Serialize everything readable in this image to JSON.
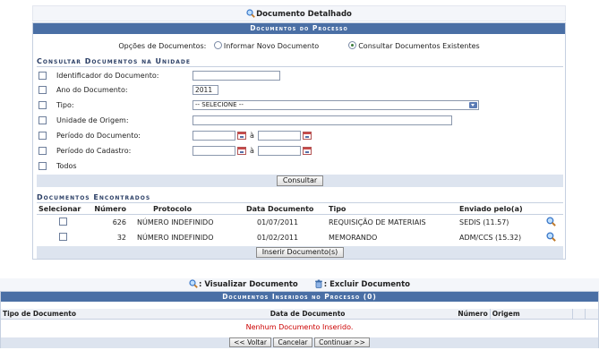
{
  "detalhado_title": "Documento Detalhado",
  "main": {
    "caption": "Documentos do Processo",
    "options_label": "Opções de Documentos:",
    "option_informar": "Informar Novo Documento",
    "option_consultar": "Consultar Documentos Existentes",
    "consultar_title": "Consultar Documentos na Unidade",
    "filters": {
      "identificador": "Identificador do Documento:",
      "ano": "Ano do Documento:",
      "ano_value": "2011",
      "tipo": "Tipo:",
      "tipo_value": "-- SELECIONE --",
      "unidade": "Unidade de Origem:",
      "periodo_doc": "Período do Documento:",
      "periodo_cad": "Período do Cadastro:",
      "a1": "à",
      "a2": "à",
      "todos": "Todos"
    },
    "consultar_button": "Consultar",
    "encontrados_title": "Documentos Encontrados",
    "columns": {
      "selecionar": "Selecionar",
      "numero": "Número",
      "protocolo": "Protocolo",
      "data": "Data Documento",
      "tipo": "Tipo",
      "enviado": "Enviado pelo(a)"
    },
    "rows": [
      {
        "numero": "626",
        "protocolo": "NÚMERO INDEFINIDO",
        "data": "01/07/2011",
        "tipo": "REQUISIÇÃO DE MATERIAIS",
        "enviado": "SEDIS (11.57)"
      },
      {
        "numero": "32",
        "protocolo": "NÚMERO INDEFINIDO",
        "data": "01/02/2011",
        "tipo": "MEMORANDO",
        "enviado": "ADM/CCS (15.32)"
      }
    ],
    "inserir_button": "Inserir Documento(s)"
  },
  "legend2": {
    "visualizar": ": Visualizar Documento",
    "excluir": ": Excluir Documento"
  },
  "inseridos": {
    "caption": "Documentos Inseridos no Processo (0)",
    "columns": {
      "tipo": "Tipo de Documento",
      "data": "Data de Documento",
      "numero": "Número",
      "origem": "Origem"
    },
    "empty": "Nenhum Documento Inserido."
  },
  "footer": {
    "voltar": "<< Voltar",
    "cancelar": "Cancelar",
    "continuar": "Continuar >>"
  },
  "colors": {
    "header_blue": "#4a6fa5",
    "section_text": "#2b3f66",
    "error_red": "#cc0000"
  }
}
